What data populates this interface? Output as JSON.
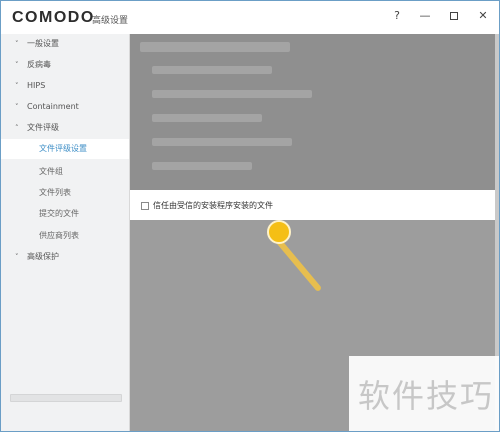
{
  "app": {
    "brand": "COMODO",
    "window_title": "高级设置"
  },
  "window_controls": {
    "help": "?",
    "minimize": "—",
    "close": "✕"
  },
  "sidebar": {
    "items": [
      {
        "label": "一般设置",
        "chevron": "˅"
      },
      {
        "label": "反病毒",
        "chevron": "˅"
      },
      {
        "label": "HIPS",
        "chevron": "˅"
      },
      {
        "label": "Containment",
        "chevron": "˅"
      },
      {
        "label": "文件评级",
        "chevron": "˄"
      }
    ],
    "subitems": [
      {
        "label": "文件评级设置",
        "active": true
      },
      {
        "label": "文件组"
      },
      {
        "label": "文件列表"
      },
      {
        "label": "提交的文件"
      },
      {
        "label": "供应商列表"
      }
    ],
    "last_item": {
      "label": "高级保护",
      "chevron": "˅"
    }
  },
  "content": {
    "option": {
      "label": "信任由受信的安装程序安装的文件",
      "checked": false
    }
  },
  "watermark": {
    "text": "软件技巧"
  },
  "colors": {
    "accent": "#3f8fc7",
    "pointer": "#f5bf15",
    "overlay": "#8f8f8f"
  }
}
